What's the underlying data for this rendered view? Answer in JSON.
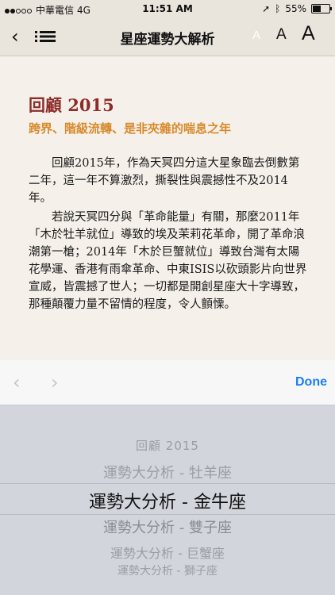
{
  "status_bar": {
    "carrier": "中華電信",
    "network": "4G",
    "time": "11:51 AM",
    "battery": "55%",
    "battery_level": 0.55
  },
  "nav": {
    "title": "星座運勢大解析",
    "font_small": "A",
    "font_medium": "A",
    "font_large": "A"
  },
  "article": {
    "heading": "回顧 2015",
    "subheading": "跨界、階級流轉、是非夾雜的喘息之年",
    "paragraphs": [
      "回顧2015年，作為天冥四分這大星象臨去倒數第二年，這一年不算激烈，撕裂性與震撼性不及2014年。",
      "若說天冥四分與「革命能量」有關，那麼2011年「木於牡羊就位」導致的埃及茉莉花革命，開了革命浪潮第一槍；2014年「木於巨蟹就位」導致台灣有太陽花學運、香港有雨傘革命、中東ISIS以砍頭影片向世界宣威，皆震撼了世人；一切都是開創星座大十字導致，那種顛覆力量不留情的程度，令人顫慄。"
    ]
  },
  "toolbar": {
    "prev_icon": "chevron-left-icon",
    "next_icon": "chevron-right-icon",
    "done_label": "Done",
    "accent": "#1a7cf7"
  },
  "picker": {
    "options": [
      "回顧 2015",
      "運勢大分析 - 牡羊座",
      "運勢大分析 - 金牛座",
      "運勢大分析 - 雙子座",
      "運勢大分析 - 巨蟹座",
      "運勢大分析 - 獅子座"
    ],
    "selected": "運勢大分析 - 金牛座"
  },
  "colors": {
    "heading": "#8c2d2a",
    "subheading": "#d88a2d",
    "paper": "#f5f1ea"
  }
}
